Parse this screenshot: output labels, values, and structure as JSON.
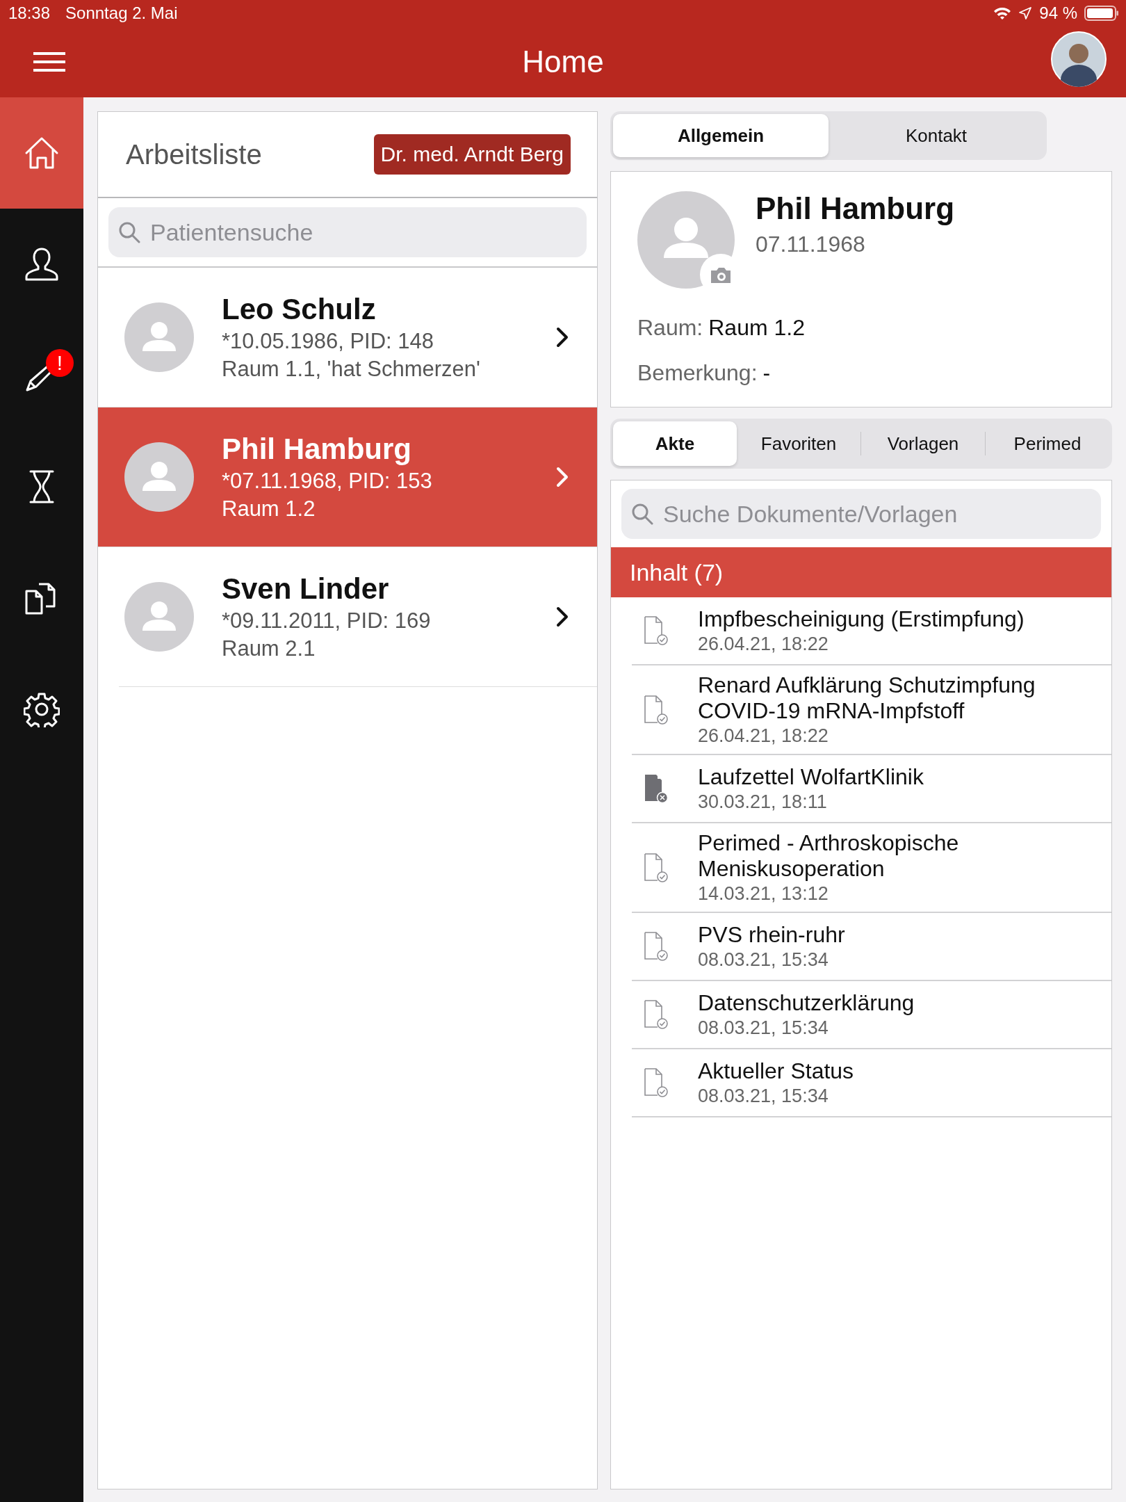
{
  "status_bar": {
    "time": "18:38",
    "date": "Sonntag 2. Mai",
    "battery": "94 %"
  },
  "header": {
    "title": "Home"
  },
  "sidebar": {
    "items": [
      {
        "kind": "home",
        "selected": true
      },
      {
        "kind": "person",
        "selected": false
      },
      {
        "kind": "pencil",
        "selected": false,
        "badge": "!"
      },
      {
        "kind": "hourglass",
        "selected": false
      },
      {
        "kind": "documents",
        "selected": false
      },
      {
        "kind": "settings",
        "selected": false
      }
    ]
  },
  "worklist": {
    "title": "Arbeitsliste",
    "doctor": "Dr. med. Arndt Berg",
    "search": {
      "placeholder": "Patientensuche"
    },
    "patients": [
      {
        "name": "Leo Schulz",
        "info": "*10.05.1986, PID: 148",
        "room": "Raum 1.1, 'hat Schmerzen'",
        "selected": false
      },
      {
        "name": "Phil Hamburg",
        "info": "*07.11.1968, PID: 153",
        "room": "Raum 1.2",
        "selected": true
      },
      {
        "name": "Sven Linder",
        "info": "*09.11.2011, PID: 169",
        "room": "Raum 2.1",
        "selected": false
      }
    ]
  },
  "detail_tabs": [
    {
      "label": "Allgemein",
      "selected": true
    },
    {
      "label": "Kontakt",
      "selected": false
    }
  ],
  "patient_card": {
    "name": "Phil Hamburg",
    "birth_date": "07.11.1968",
    "room_label": "Raum:",
    "room": "Raum 1.2",
    "remark_label": "Bemerkung:",
    "remark": "-"
  },
  "document_tabs": [
    {
      "label": "Akte",
      "selected": true
    },
    {
      "label": "Favoriten",
      "selected": false
    },
    {
      "label": "Vorlagen",
      "selected": false
    },
    {
      "label": "Perimed",
      "selected": false
    }
  ],
  "documents": {
    "search": {
      "placeholder": "Suche Dokumente/Vorlagen"
    },
    "header": "Inhalt (7)",
    "items": [
      {
        "title": "Impfbescheinigung (Erstimpfung)",
        "date": "26.04.21, 18:22",
        "kind": "signed"
      },
      {
        "title": "Renard Aufklärung Schutzimpfung COVID-19 mRNA-Impfstoff",
        "date": "26.04.21, 18:22",
        "kind": "signed"
      },
      {
        "title": "Laufzettel WolfartKlinik",
        "date": "30.03.21, 18:11",
        "kind": "cancelled"
      },
      {
        "title": "Perimed - Arthroskopische Meniskusoperation",
        "date": "14.03.21, 13:12",
        "kind": "signed"
      },
      {
        "title": "PVS rhein-ruhr",
        "date": "08.03.21, 15:34",
        "kind": "signed"
      },
      {
        "title": "Datenschutzerklärung",
        "date": "08.03.21, 15:34",
        "kind": "signed"
      },
      {
        "title": "Aktueller Status",
        "date": "08.03.21, 15:34",
        "kind": "signed"
      }
    ]
  }
}
